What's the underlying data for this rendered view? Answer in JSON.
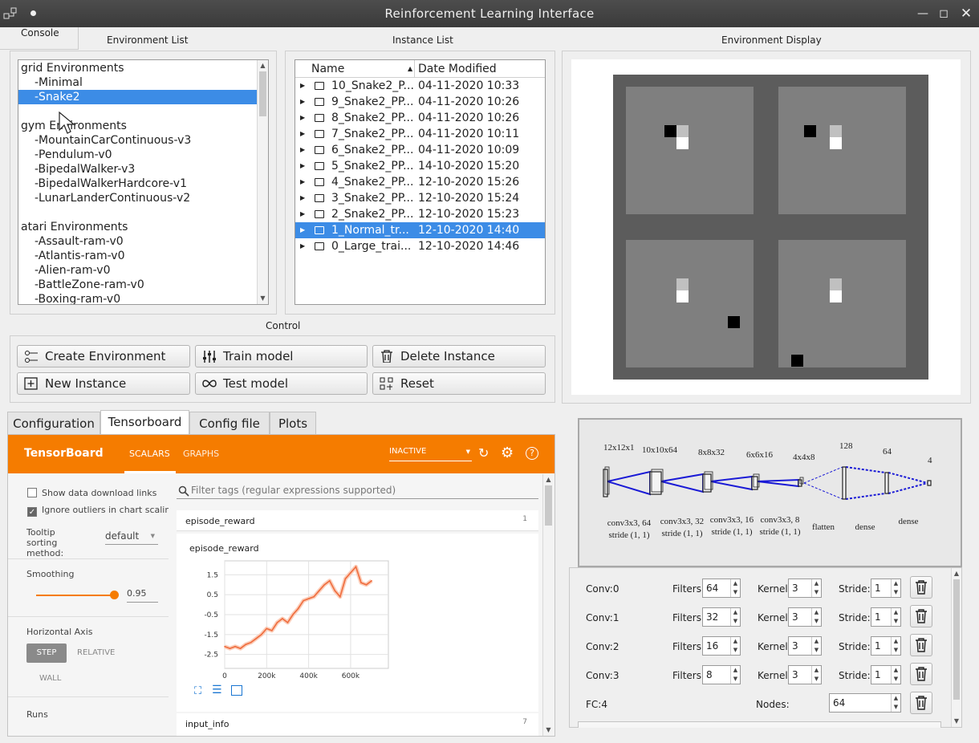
{
  "window": {
    "title": "Reinforcement Learning Interface"
  },
  "console_tab": "Console",
  "sections": {
    "environment_list": "Environment List",
    "instance_list": "Instance List",
    "environment_display": "Environment Display",
    "control": "Control"
  },
  "environments": [
    {
      "label": "grid Environments",
      "group": true
    },
    {
      "label": "-Minimal"
    },
    {
      "label": "-Snake2",
      "selected": true
    },
    {
      "gap": true
    },
    {
      "label": "gym Environments",
      "group": true
    },
    {
      "label": "-MountainCarContinuous-v3"
    },
    {
      "label": "-Pendulum-v0"
    },
    {
      "label": "-BipedalWalker-v3"
    },
    {
      "label": "-BipedalWalkerHardcore-v1"
    },
    {
      "label": "-LunarLanderContinuous-v2"
    },
    {
      "gap": true
    },
    {
      "label": "atari Environments",
      "group": true
    },
    {
      "label": "-Assault-ram-v0"
    },
    {
      "label": "-Atlantis-ram-v0"
    },
    {
      "label": "-Alien-ram-v0"
    },
    {
      "label": "-BattleZone-ram-v0"
    },
    {
      "label": "-Boxing-ram-v0"
    }
  ],
  "instance_table": {
    "columns": [
      "Name",
      "Date Modified"
    ],
    "rows": [
      {
        "name": "10_Snake2_P...",
        "date": "04-11-2020 10:33"
      },
      {
        "name": "9_Snake2_PP...",
        "date": "04-11-2020 10:26"
      },
      {
        "name": "8_Snake2_PP...",
        "date": "04-11-2020 10:26"
      },
      {
        "name": "7_Snake2_PP...",
        "date": "04-11-2020 10:11"
      },
      {
        "name": "6_Snake2_PP...",
        "date": "04-11-2020 10:09"
      },
      {
        "name": "5_Snake2_PP...",
        "date": "14-10-2020 15:20"
      },
      {
        "name": "4_Snake2_PP...",
        "date": "12-10-2020 15:26"
      },
      {
        "name": "3_Snake2_PP...",
        "date": "12-10-2020 15:24"
      },
      {
        "name": "2_Snake2_PP...",
        "date": "12-10-2020 15:23"
      },
      {
        "name": "1_Normal_tr...",
        "date": "12-10-2020 14:40",
        "selected": true
      },
      {
        "name": "0_Large_trai...",
        "date": "12-10-2020 14:46"
      }
    ]
  },
  "control": {
    "create_environment": "Create Environment",
    "train_model": "Train model",
    "delete_instance": "Delete Instance",
    "new_instance": "New Instance",
    "test_model": "Test model",
    "reset": "Reset"
  },
  "tabs": [
    "Configuration",
    "Tensorboard",
    "Config file",
    "Plots"
  ],
  "tensorboard": {
    "brand": "TensorBoard",
    "nav_scalars": "SCALARS",
    "nav_graphs": "GRAPHS",
    "run_state": "INACTIVE",
    "show_download": "Show data download links",
    "ignore_outliers": "Ignore outliers in chart scalin",
    "tooltip_label": "Tooltip sorting method:",
    "tooltip_value": "default",
    "smoothing_label": "Smoothing",
    "smoothing_value": "0.95",
    "horizontal_axis": "Horizontal Axis",
    "axis_step": "STEP",
    "axis_relative": "RELATIVE",
    "axis_wall": "WALL",
    "runs": "Runs",
    "filter_placeholder": "Filter tags (regular expressions supported)",
    "card1_title": "episode_reward",
    "card1_count": "1",
    "chart_title": "episode_reward",
    "card2_title": "input_info",
    "card2_count": "7",
    "accent": "#f57c00"
  },
  "chart_data": {
    "type": "line",
    "title": "episode_reward",
    "x": [
      0,
      25000,
      50000,
      75000,
      100000,
      125000,
      150000,
      175000,
      200000,
      225000,
      250000,
      275000,
      300000,
      325000,
      350000,
      375000,
      400000,
      425000,
      450000,
      475000,
      500000,
      525000,
      550000,
      575000,
      600000,
      625000,
      650000,
      675000,
      700000
    ],
    "series": [
      {
        "values": [
          -2.1,
          -2.2,
          -2.1,
          -2.2,
          -2.0,
          -1.9,
          -1.7,
          -1.5,
          -1.2,
          -1.3,
          -0.9,
          -0.7,
          -0.9,
          -0.5,
          -0.2,
          0.2,
          0.3,
          0.4,
          0.7,
          1.0,
          1.2,
          0.7,
          0.4,
          1.3,
          1.6,
          1.9,
          1.1,
          1.0,
          1.2
        ]
      }
    ],
    "yticks": [
      "1.5",
      "0.5",
      "-0.5",
      "-1.5",
      "-2.5"
    ],
    "xticks": [
      "0",
      "200k",
      "400k",
      "600k"
    ],
    "ylim": [
      -3.2,
      2.2
    ],
    "xlim": [
      0,
      780000
    ],
    "grid": true,
    "color": "#ef6c3d"
  },
  "network_diagram": {
    "sizes": [
      "12x12x1",
      "10x10x64",
      "8x8x32",
      "6x6x16",
      "4x4x8",
      "128",
      "64",
      "4"
    ],
    "layer_labels": [
      "conv3x3, 64\nstride (1, 1)",
      "conv3x3, 32\nstride (1, 1)",
      "conv3x3, 16\nstride (1, 1)",
      "conv3x3, 8\nstride (1, 1)",
      "flatten",
      "dense",
      "dense"
    ]
  },
  "layers": [
    {
      "name": "Conv:0",
      "filters_label": "Filters:",
      "filters": "64",
      "kernel_label": "Kernel:",
      "kernel": "3",
      "stride_label": "Stride:",
      "stride": "1"
    },
    {
      "name": "Conv:1",
      "filters_label": "Filters:",
      "filters": "32",
      "kernel_label": "Kernel:",
      "kernel": "3",
      "stride_label": "Stride:",
      "stride": "1"
    },
    {
      "name": "Conv:2",
      "filters_label": "Filters:",
      "filters": "16",
      "kernel_label": "Kernel:",
      "kernel": "3",
      "stride_label": "Stride:",
      "stride": "1"
    },
    {
      "name": "Conv:3",
      "filters_label": "Filters:",
      "filters": "8",
      "kernel_label": "Kernel:",
      "kernel": "3",
      "stride_label": "Stride:",
      "stride": "1"
    }
  ],
  "fc_layer": {
    "name": "FC:4",
    "nodes_label": "Nodes:",
    "nodes": "64"
  }
}
